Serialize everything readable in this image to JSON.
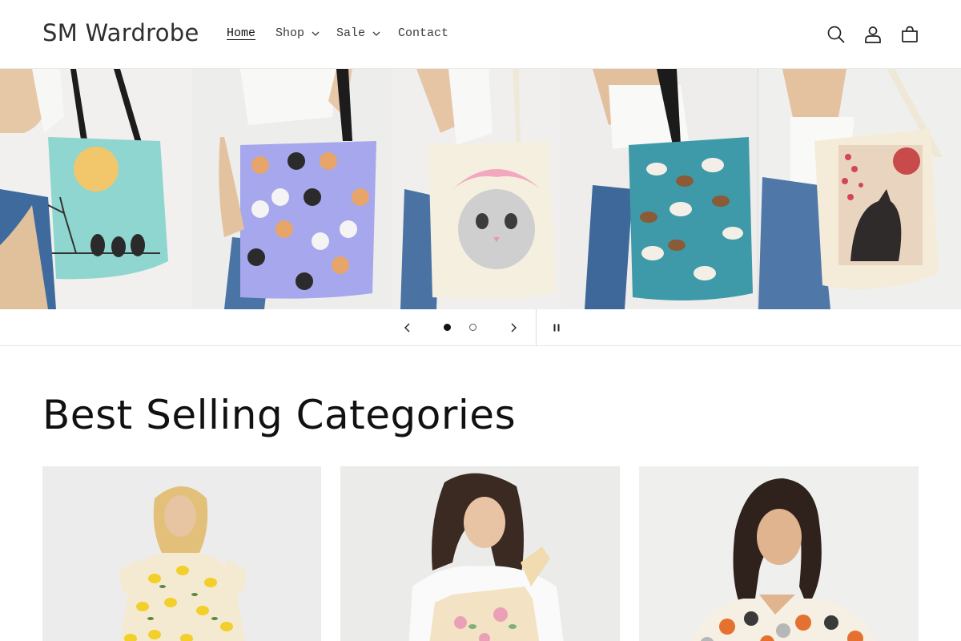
{
  "store": {
    "name": "SM Wardrobe"
  },
  "nav": {
    "home": "Home",
    "shop": "Shop",
    "sale": "Sale",
    "contact": "Contact"
  },
  "header_icons": [
    "search-icon",
    "account-icon",
    "cart-icon"
  ],
  "hero": {
    "slide_count": 2,
    "current_slide": 1,
    "panels": [
      {
        "product": "tote bag",
        "design": "cats on branch under moon"
      },
      {
        "product": "tote bag",
        "design": "cat faces pattern"
      },
      {
        "product": "tote bag",
        "design": "cat with pink headwrap"
      },
      {
        "product": "tote bag",
        "design": "dogs pattern"
      },
      {
        "product": "tote bag",
        "design": "cat with cherry blossoms"
      }
    ]
  },
  "section": {
    "title": "Best Selling Categories"
  },
  "categories": [
    {
      "image": "lemon print dress"
    },
    {
      "image": "floral overalls"
    },
    {
      "image": "cat print shirt"
    }
  ],
  "colors": {
    "accent": "#121212",
    "muted_text": "#3a3a3a",
    "border": "#e6e6e6"
  }
}
